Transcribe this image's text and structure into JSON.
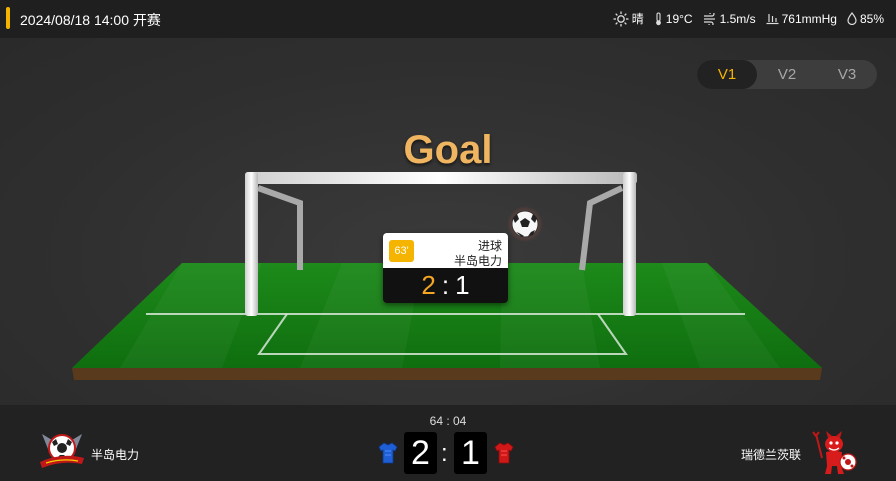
{
  "header": {
    "match_time": "2024/08/18 14:00 开赛",
    "weather": {
      "condition": "晴",
      "temperature": "19°C",
      "wind": "1.5m/s",
      "pressure": "761mmHg",
      "humidity": "85%"
    },
    "icons": [
      "sun-icon",
      "thermometer-icon",
      "wind-icon",
      "pressure-icon",
      "humidity-drop-icon"
    ],
    "accent_color": "#f5b400"
  },
  "view_tabs": [
    {
      "label": "V1",
      "active": true
    },
    {
      "label": "V2",
      "active": false
    },
    {
      "label": "V3",
      "active": false
    }
  ],
  "animation": {
    "title": "Goal",
    "event_card": {
      "minute": "63'",
      "event_type": "进球",
      "team": "半岛电力",
      "home_score": "2",
      "away_score": "1",
      "separator": ":"
    }
  },
  "scoreboard": {
    "clock": "64 : 04",
    "home_team": "半岛电力",
    "away_team": "瑞德兰茨联",
    "home_score": "2",
    "away_score": "1",
    "separator": ":",
    "home_jersey_color": "#1f5fd6",
    "away_jersey_color": "#d01818"
  }
}
